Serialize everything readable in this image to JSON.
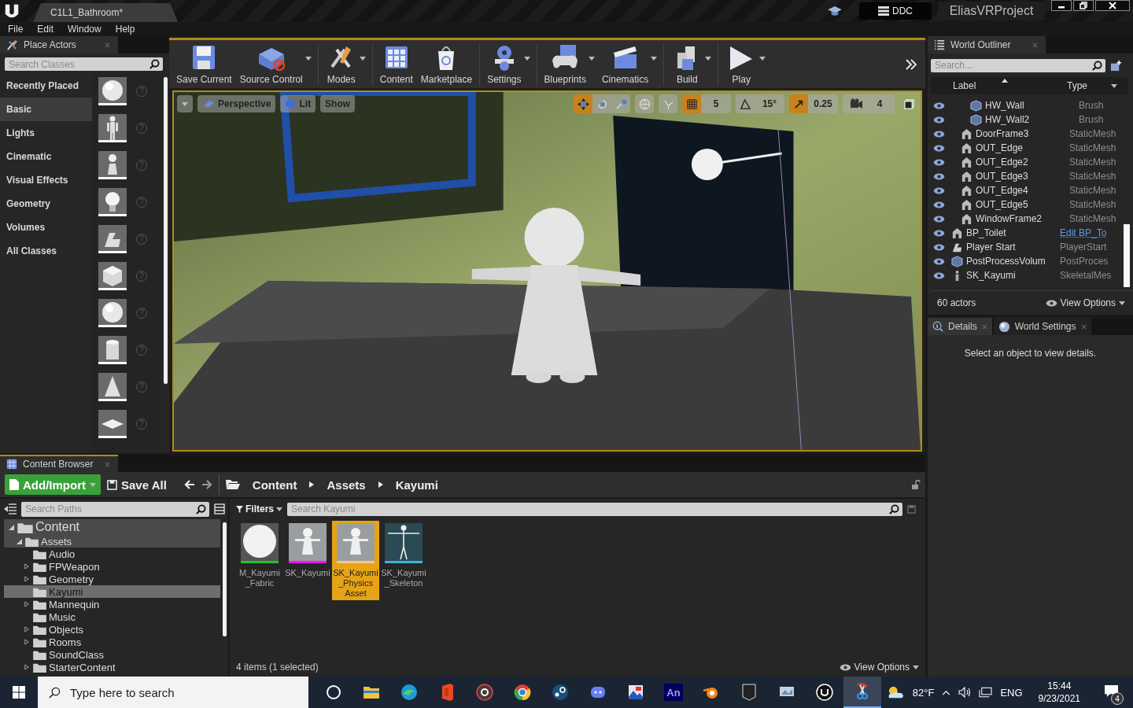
{
  "title_bar": {
    "document_tab": "C1L1_Bathroom*",
    "ddc": "DDC",
    "project": "EliasVRProject"
  },
  "menu": [
    "File",
    "Edit",
    "Window",
    "Help"
  ],
  "place_actors": {
    "tab": "Place Actors",
    "search_placeholder": "Search Classes",
    "categories": [
      {
        "label": "Recently Placed",
        "selected": false
      },
      {
        "label": "Basic",
        "selected": true
      },
      {
        "label": "Lights",
        "selected": false
      },
      {
        "label": "Cinematic",
        "selected": false
      },
      {
        "label": "Visual Effects",
        "selected": false
      },
      {
        "label": "Geometry",
        "selected": false
      },
      {
        "label": "Volumes",
        "selected": false
      },
      {
        "label": "All Classes",
        "selected": false
      }
    ],
    "actors": [
      {
        "kind": "sphere",
        "help": "?"
      },
      {
        "kind": "figure",
        "help": "?"
      },
      {
        "kind": "pawn",
        "help": "?"
      },
      {
        "kind": "bulb",
        "help": "?"
      },
      {
        "kind": "player",
        "help": "?"
      },
      {
        "kind": "cube",
        "help": "?"
      },
      {
        "kind": "sphere",
        "help": "?"
      },
      {
        "kind": "cylinder",
        "help": "?"
      },
      {
        "kind": "cone",
        "help": "?"
      },
      {
        "kind": "plane",
        "help": "?"
      }
    ]
  },
  "toolbar": [
    [
      {
        "label": "Save Current",
        "kind": "save",
        "dropdown": false
      },
      {
        "label": "Source Control",
        "kind": "source",
        "dropdown": true
      }
    ],
    [
      {
        "label": "Modes",
        "kind": "modes",
        "dropdown": true
      }
    ],
    [
      {
        "label": "Content",
        "kind": "content",
        "dropdown": false
      },
      {
        "label": "Marketplace",
        "kind": "market",
        "dropdown": false
      }
    ],
    [
      {
        "label": "Settings",
        "kind": "settings",
        "dropdown": true
      }
    ],
    [
      {
        "label": "Blueprints",
        "kind": "blueprints",
        "dropdown": true
      },
      {
        "label": "Cinematics",
        "kind": "cinematics",
        "dropdown": true
      }
    ],
    [
      {
        "label": "Build",
        "kind": "build",
        "dropdown": true
      }
    ],
    [
      {
        "label": "Play",
        "kind": "play",
        "dropdown": true
      }
    ]
  ],
  "viewport": {
    "view": "Perspective",
    "lighting": "Lit",
    "show": "Show",
    "transform_tools": [
      {
        "kind": "move",
        "selected": true
      },
      {
        "kind": "rotate",
        "selected": false
      },
      {
        "kind": "scale",
        "selected": false
      }
    ],
    "snaps": [
      {
        "kind": "grid",
        "on": true,
        "value": "5"
      },
      {
        "kind": "rotation",
        "on": false,
        "value": "15°"
      },
      {
        "kind": "scale",
        "on": true,
        "value": "0.25"
      }
    ],
    "camera_speed": "4"
  },
  "outliner": {
    "tab": "World Outliner",
    "search_placeholder": "Search...",
    "columns": [
      "Label",
      "Type"
    ],
    "rows": [
      {
        "children": [
          {
            "children": [
              {
                "label": "HW_Wall",
                "type": "Brush",
                "kind": "brush",
                "type_link": false
              },
              {
                "label": "HW_Wall2",
                "type": "Brush",
                "kind": "brush",
                "type_link": false
              }
            ]
          },
          {
            "label": "DoorFrame3",
            "type": "StaticMesh",
            "kind": "mesh",
            "type_link": false
          },
          {
            "label": "OUT_Edge",
            "type": "StaticMesh",
            "kind": "mesh",
            "type_link": false
          },
          {
            "label": "OUT_Edge2",
            "type": "StaticMesh",
            "kind": "mesh",
            "type_link": false
          },
          {
            "label": "OUT_Edge3",
            "type": "StaticMesh",
            "kind": "mesh",
            "type_link": false
          },
          {
            "label": "OUT_Edge4",
            "type": "StaticMesh",
            "kind": "mesh",
            "type_link": false
          },
          {
            "label": "OUT_Edge5",
            "type": "StaticMesh",
            "kind": "mesh",
            "type_link": false
          },
          {
            "label": "WindowFrame2",
            "type": "StaticMesh",
            "kind": "mesh",
            "type_link": false
          }
        ]
      },
      {
        "label": "BP_Toilet",
        "type": "Edit BP_To",
        "kind": "mesh",
        "type_link": true
      },
      {
        "label": "Player Start",
        "type": "PlayerStart",
        "kind": "player",
        "type_link": false
      },
      {
        "label": "PostProcessVolum",
        "type": "PostProces",
        "kind": "brush",
        "type_link": false
      },
      {
        "label": "SK_Kayumi",
        "type": "SkeletalMes",
        "kind": "skeletal",
        "type_link": false
      }
    ],
    "actor_count": "60 actors",
    "view_options": "View Options"
  },
  "details": {
    "tabs": [
      {
        "label": "Details",
        "kind": "details",
        "selected": true
      },
      {
        "label": "World Settings",
        "kind": "world",
        "selected": false
      }
    ],
    "message": "Select an object to view details."
  },
  "content_browser": {
    "tab": "Content Browser",
    "add_import": "Add/Import",
    "save_all": "Save All",
    "path": [
      "Content",
      "Assets",
      "Kayumi"
    ],
    "search_paths_placeholder": "Search Paths",
    "tree": [
      {
        "label": "Content",
        "expandable": true,
        "expanded": true,
        "selected": false,
        "children": [
          {
            "label": "Assets",
            "expandable": true,
            "expanded": true,
            "selected": false,
            "children": [
              {
                "label": "Audio",
                "expandable": false,
                "selected": false
              },
              {
                "label": "FPWeapon",
                "expandable": true,
                "expanded": false,
                "selected": false
              },
              {
                "label": "Geometry",
                "expandable": true,
                "expanded": false,
                "selected": false
              },
              {
                "label": "Kayumi",
                "expandable": false,
                "selected": true
              },
              {
                "label": "Mannequin",
                "expandable": true,
                "expanded": false,
                "selected": false
              },
              {
                "label": "Music",
                "expandable": false,
                "selected": false
              },
              {
                "label": "Objects",
                "expandable": true,
                "expanded": false,
                "selected": false
              },
              {
                "label": "Rooms",
                "expandable": true,
                "expanded": false,
                "selected": false
              },
              {
                "label": "SoundClass",
                "expandable": false,
                "selected": false
              },
              {
                "label": "StarterContent",
                "expandable": true,
                "expanded": false,
                "selected": false
              }
            ]
          }
        ]
      }
    ],
    "filters": "Filters",
    "search_placeholder": "Search Kayumi",
    "assets": [
      {
        "name": "M_Kayumi\n_Fabric",
        "kind": "material",
        "color": "#22c32e",
        "selected": false
      },
      {
        "name": "SK_Kayumi",
        "kind": "mesh",
        "color": "#ff10ff",
        "selected": false
      },
      {
        "name": "SK_Kayumi\n_Physics\nAsset",
        "kind": "mesh",
        "color": "#ffc383",
        "selected": true
      },
      {
        "name": "SK_Kayumi\n_Skeleton",
        "kind": "skeleton",
        "color": "#3fb4dc",
        "selected": false
      }
    ],
    "status": "4 items (1 selected)",
    "view_options": "View Options"
  },
  "taskbar": {
    "search_placeholder": "Type here to search",
    "apps": [
      {
        "kind": "cortana",
        "active": false
      },
      {
        "kind": "folder",
        "active": false
      },
      {
        "kind": "edge",
        "active": false
      },
      {
        "kind": "office",
        "active": false
      },
      {
        "kind": "disc",
        "active": false
      },
      {
        "kind": "chrome",
        "active": false
      },
      {
        "kind": "steam",
        "active": false
      },
      {
        "kind": "discord",
        "active": false
      },
      {
        "kind": "picture",
        "active": false
      },
      {
        "kind": "animate",
        "label": "An",
        "active": false
      },
      {
        "kind": "blender",
        "active": false
      },
      {
        "kind": "epic",
        "active": false
      },
      {
        "kind": "monitor",
        "active": false
      },
      {
        "kind": "unreal",
        "active": false
      },
      {
        "kind": "snip",
        "active": true
      }
    ],
    "weather": "82°F",
    "language": "ENG",
    "time": "15:44",
    "date": "9/23/2021",
    "notifications": "4"
  }
}
